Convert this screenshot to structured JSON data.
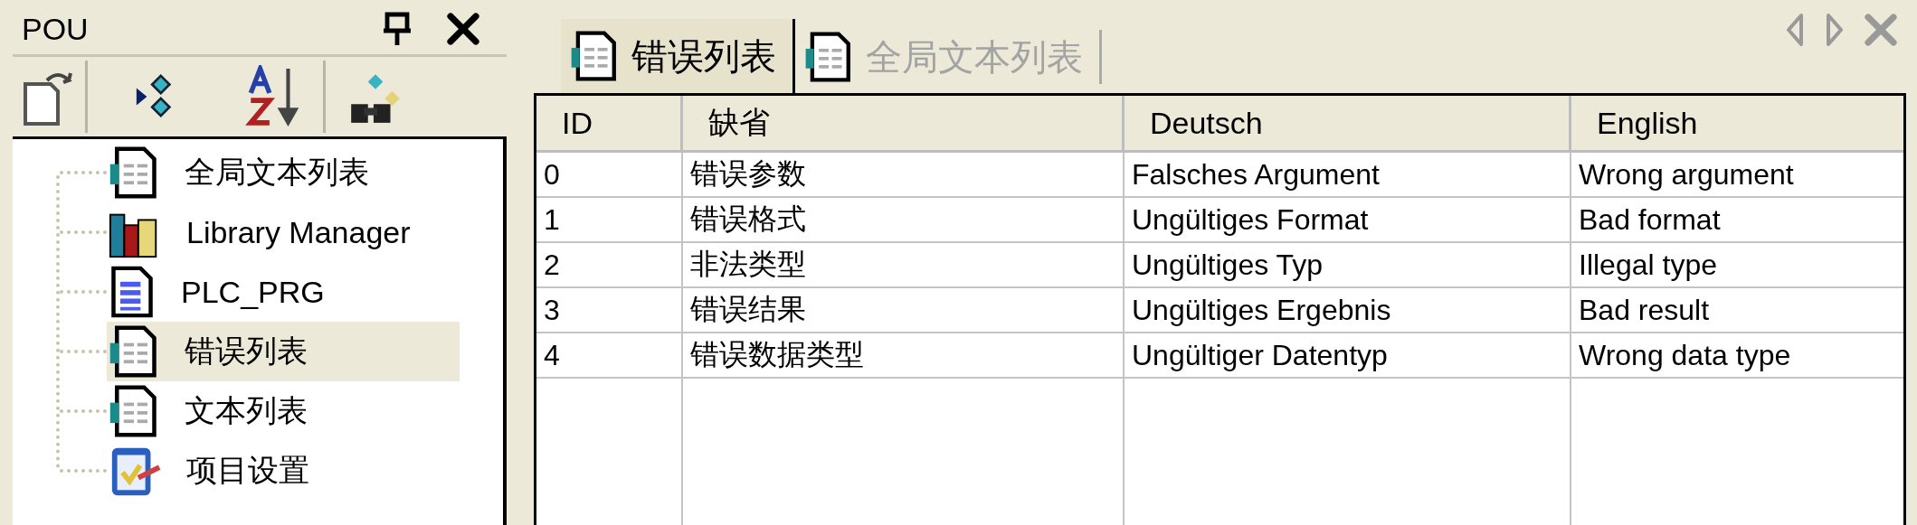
{
  "panel": {
    "title": "POU"
  },
  "toolbar": [
    {
      "kind": "copy"
    },
    {
      "kind": "expand"
    },
    {
      "kind": "sort"
    },
    {
      "kind": "find"
    }
  ],
  "tree": [
    {
      "label": "全局文本列表",
      "kind": "textlist",
      "selected": false
    },
    {
      "label": "Library Manager",
      "kind": "library",
      "selected": false
    },
    {
      "label": "PLC_PRG",
      "kind": "program",
      "selected": false
    },
    {
      "label": "错误列表",
      "kind": "textlist",
      "selected": true
    },
    {
      "label": "文本列表",
      "kind": "textlist",
      "selected": false
    },
    {
      "label": "项目设置",
      "kind": "settings",
      "selected": false
    }
  ],
  "tabs": [
    {
      "label": "错误列表",
      "selected": true
    },
    {
      "label": "全局文本列表",
      "selected": false
    }
  ],
  "table": {
    "columns": [
      "ID",
      "缺省",
      "Deutsch",
      "English"
    ],
    "rows": [
      [
        "0",
        "错误参数",
        "Falsches Argument",
        "Wrong argument"
      ],
      [
        "1",
        "错误格式",
        "Ungültiges Format",
        "Bad format"
      ],
      [
        "2",
        "非法类型",
        "Ungültiges Typ",
        "Illegal type"
      ],
      [
        "3",
        "错误结果",
        "Ungültiges Ergebnis",
        "Bad result"
      ],
      [
        "4",
        "错误数据类型",
        "Ungültiger Datentyp",
        "Wrong data type"
      ]
    ]
  }
}
